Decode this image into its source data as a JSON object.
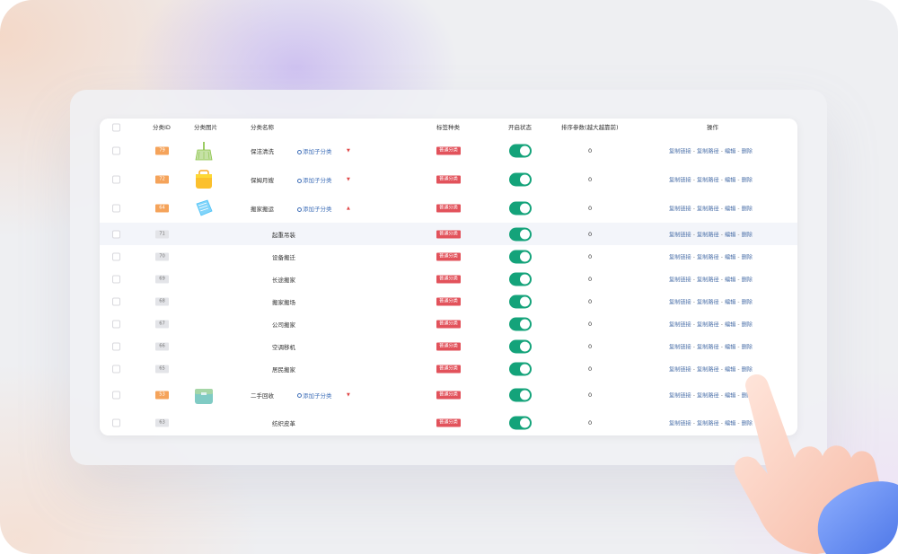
{
  "table": {
    "headers": {
      "id": "分类ID",
      "image": "分类图片",
      "name": "分类名称",
      "tag_type": "标签种类",
      "enabled": "开启状态",
      "sort": "排序参数(越大越靠前)",
      "actions": "操作"
    },
    "rows": [
      {
        "id": "79",
        "level": "parent",
        "name": "保洁清洗",
        "image_icon": "broom-icon",
        "add_sub": "添加子分类",
        "tag": "普通分类",
        "enabled": true,
        "sort": "0"
      },
      {
        "id": "72",
        "level": "parent",
        "name": "保姆月嫂",
        "image_icon": "yellow-box-icon",
        "add_sub": "添加子分类",
        "tag": "普通分类",
        "enabled": true,
        "sort": "0"
      },
      {
        "id": "64",
        "level": "parent",
        "name": "搬家搬运",
        "image_icon": "blue-box-icon",
        "add_sub": "添加子分类",
        "tag": "普通分类",
        "enabled": true,
        "sort": "0"
      },
      {
        "id": "71",
        "level": "child",
        "name": "起重吊装",
        "tag": "普通分类",
        "enabled": true,
        "sort": "0",
        "highlighted": true
      },
      {
        "id": "70",
        "level": "child",
        "name": "设备搬迁",
        "tag": "普通分类",
        "enabled": true,
        "sort": "0"
      },
      {
        "id": "69",
        "level": "child",
        "name": "长途搬家",
        "tag": "普通分类",
        "enabled": true,
        "sort": "0"
      },
      {
        "id": "68",
        "level": "child",
        "name": "搬家搬场",
        "tag": "普通分类",
        "enabled": true,
        "sort": "0"
      },
      {
        "id": "67",
        "level": "child",
        "name": "公司搬家",
        "tag": "普通分类",
        "enabled": true,
        "sort": "0"
      },
      {
        "id": "66",
        "level": "child",
        "name": "空调移机",
        "tag": "普通分类",
        "enabled": true,
        "sort": "0"
      },
      {
        "id": "65",
        "level": "child",
        "name": "居民搬家",
        "tag": "普通分类",
        "enabled": true,
        "sort": "0"
      },
      {
        "id": "53",
        "level": "parent",
        "name": "二手回收",
        "image_icon": "green-box-icon",
        "add_sub": "添加子分类",
        "tag": "普通分类",
        "enabled": true,
        "sort": "0"
      },
      {
        "id": "63",
        "level": "child",
        "name": "纺织皮革",
        "tag": "普通分类",
        "enabled": true,
        "sort": "0"
      }
    ],
    "row_actions": {
      "copy_link": "复制链接",
      "copy_path": "复制路径",
      "edit": "编辑",
      "delete": "删除",
      "separator": "-"
    }
  },
  "colors": {
    "id_badge_parent": "#f5a35a",
    "id_badge_child": "#e3e4e8",
    "tag_red": "#e2525b",
    "toggle_on": "#14a37a",
    "link_blue": "#4a6fa8"
  },
  "decor": {
    "hand_icon": "pointing-hand-icon"
  }
}
